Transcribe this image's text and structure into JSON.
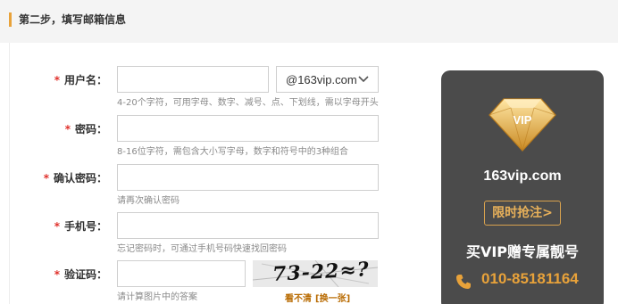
{
  "step": {
    "title": "第二步，填写邮箱信息"
  },
  "form": {
    "username": {
      "required_mark": "*",
      "label": "用户名：",
      "value": "",
      "hint": "4-20个字符，可用字母、数字、减号、点、下划线，需以字母开头"
    },
    "domain": {
      "selected": "@163vip.com",
      "icon": "chevron-down-icon"
    },
    "password": {
      "required_mark": "*",
      "label": "密码：",
      "value": "",
      "hint": "8-16位字符，需包含大小写字母，数字和符号中的3种组合"
    },
    "confirm": {
      "required_mark": "*",
      "label": "确认密码：",
      "value": "",
      "hint": "请再次确认密码"
    },
    "phone": {
      "required_mark": "*",
      "label": "手机号：",
      "value": "",
      "hint": "忘记密码时，可通过手机号码快速找回密码"
    },
    "captcha": {
      "required_mark": "*",
      "label": "验证码：",
      "value": "",
      "hint": "请计算图片中的答案",
      "image_text": "73-22≈?",
      "cant_see": "看不清",
      "refresh": "[换一张]"
    }
  },
  "promo": {
    "domain": "163vip.com",
    "button": "限时抢注>",
    "slogan": "买VIP赠专属靓号",
    "phone": "010-85181164",
    "gem_text": "VIP",
    "colors": {
      "card": "#4b4b4b",
      "gold": "#e8a23a"
    }
  }
}
